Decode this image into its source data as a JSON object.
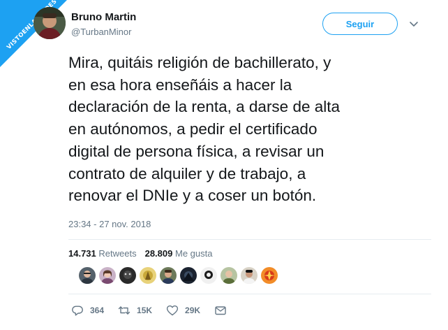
{
  "watermark": {
    "text": "VISTOENLASREDES"
  },
  "author": {
    "name": "Bruno Martin",
    "handle": "@TurbanMinor",
    "avatar_icon": "profile-photo"
  },
  "follow_button": {
    "label": "Seguir"
  },
  "tweet": {
    "lines": [
      "Mira, quitáis religión de bachillerato, y",
      "en esa hora enseñáis a hacer la",
      "declaración de la renta, a darse de alta",
      "en autónomos, a pedir el certificado",
      "digital de persona física, a revisar un",
      "contrato de alquiler y de trabajo, a",
      "renovar el DNIe y a coser un botón."
    ],
    "timestamp": "23:34 - 27 nov. 2018"
  },
  "stats": {
    "retweets_count": "14.731",
    "retweets_label": "Retweets",
    "likes_count": "28.809",
    "likes_label": "Me gusta"
  },
  "likers": [
    {
      "icon": "user-avatar"
    },
    {
      "icon": "user-avatar"
    },
    {
      "icon": "user-avatar"
    },
    {
      "icon": "user-avatar"
    },
    {
      "icon": "user-avatar"
    },
    {
      "icon": "user-avatar"
    },
    {
      "icon": "user-avatar"
    },
    {
      "icon": "user-avatar"
    },
    {
      "icon": "user-avatar"
    },
    {
      "icon": "user-avatar"
    }
  ],
  "actions": {
    "reply_count": "364",
    "retweet_count": "15K",
    "like_count": "29K"
  },
  "colors": {
    "accent": "#1da1f2",
    "text": "#14171a",
    "muted": "#657786",
    "divider": "#e6ecf0"
  }
}
